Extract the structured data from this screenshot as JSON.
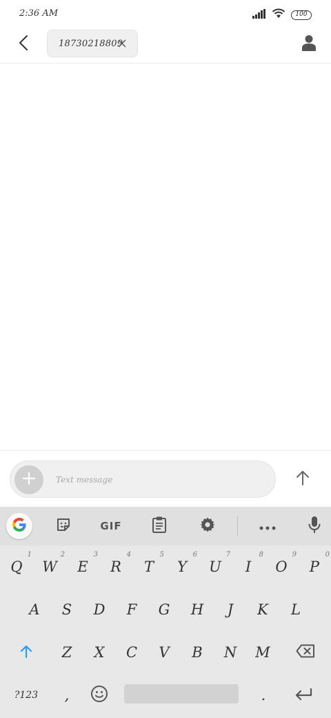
{
  "status_bar": {
    "time": "2:36 AM",
    "battery": "100",
    "icons": [
      "signal-icon",
      "wifi-icon",
      "battery-icon"
    ]
  },
  "header": {
    "recipient": "18730218809",
    "icons": [
      "back-arrow-icon",
      "close-icon",
      "contact-icon"
    ]
  },
  "composer": {
    "placeholder": "Text message",
    "icons": [
      "plus-icon",
      "send-arrow-icon"
    ]
  },
  "keyboard": {
    "toolbar": {
      "gif_label": "GIF",
      "icons": [
        "google-icon",
        "sticker-icon",
        "clipboard-icon",
        "gear-icon",
        "more-icon",
        "microphone-icon"
      ]
    },
    "row1": [
      {
        "label": "Q",
        "hint": "1"
      },
      {
        "label": "W",
        "hint": "2"
      },
      {
        "label": "E",
        "hint": "3"
      },
      {
        "label": "R",
        "hint": "4"
      },
      {
        "label": "T",
        "hint": "5"
      },
      {
        "label": "Y",
        "hint": "6"
      },
      {
        "label": "U",
        "hint": "7"
      },
      {
        "label": "I",
        "hint": "8"
      },
      {
        "label": "O",
        "hint": "9"
      },
      {
        "label": "P",
        "hint": "0"
      }
    ],
    "row2": [
      "A",
      "S",
      "D",
      "F",
      "G",
      "H",
      "J",
      "K",
      "L"
    ],
    "row3": [
      "Z",
      "X",
      "C",
      "V",
      "B",
      "N",
      "M"
    ],
    "row4": {
      "symbols": "?123",
      "comma": ",",
      "period": "."
    },
    "accent_color": "#2a9df4"
  }
}
